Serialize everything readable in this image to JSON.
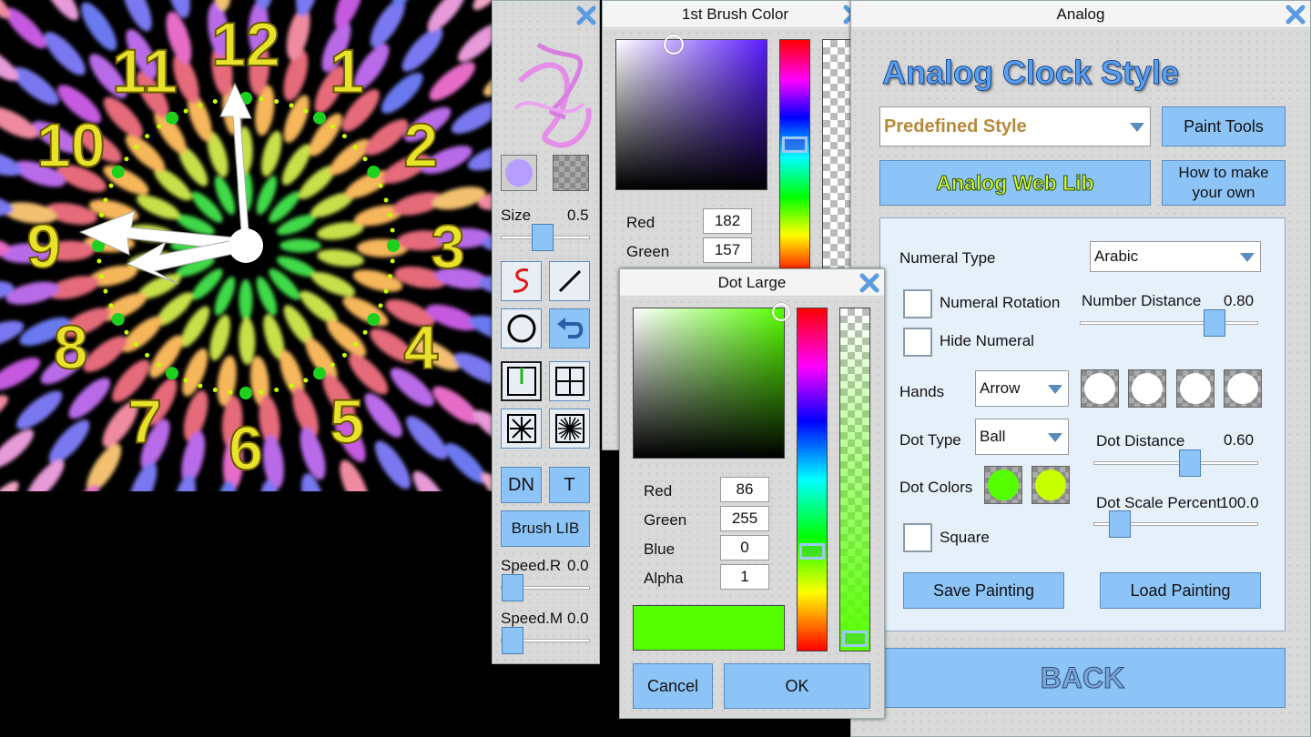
{
  "clock": {
    "numerals": [
      "12",
      "1",
      "2",
      "3",
      "4",
      "5",
      "6",
      "7",
      "8",
      "9",
      "10",
      "11"
    ]
  },
  "toolbox": {
    "size_label": "Size",
    "size_value": "0.5",
    "size_fraction": 0.5,
    "dn_label": "DN",
    "t_label": "T",
    "brush_lib_label": "Brush LIB",
    "speed_r_label": "Speed.R",
    "speed_r_value": "0.0",
    "speed_m_label": "Speed.M",
    "speed_m_value": "0.0"
  },
  "brush_color": {
    "title": "1st Brush Color",
    "red_label": "Red",
    "red_value": "182",
    "green_label": "Green",
    "green_value": "157"
  },
  "dot_large": {
    "title": "Dot Large",
    "red_label": "Red",
    "red_value": "86",
    "green_label": "Green",
    "green_value": "255",
    "blue_label": "Blue",
    "blue_value": "0",
    "alpha_label": "Alpha",
    "alpha_value": "1",
    "preview_color": "#56ff00",
    "cancel_label": "Cancel",
    "ok_label": "OK"
  },
  "analog": {
    "window_title": "Analog",
    "heading": "Analog Clock Style",
    "style_dropdown": "Predefined Style",
    "paint_tools_label": "Paint Tools",
    "web_lib_label": "Analog Web Lib",
    "how_to_label": "How to make your own",
    "numeral_type_label": "Numeral Type",
    "numeral_type_value": "Arabic",
    "numeral_rotation_label": "Numeral Rotation",
    "number_distance_label": "Number Distance",
    "number_distance_value": "0.80",
    "hide_numeral_label": "Hide Numeral",
    "hands_label": "Hands",
    "hands_value": "Arrow",
    "dot_type_label": "Dot Type",
    "dot_type_value": "Ball",
    "dot_distance_label": "Dot Distance",
    "dot_distance_value": "0.60",
    "dot_colors_label": "Dot Colors",
    "dot_color_1": "#56ff00",
    "dot_color_2": "#c8ff00",
    "dot_scale_label": "Dot Scale Percent",
    "dot_scale_value": "100.0",
    "square_label": "Square",
    "save_label": "Save Painting",
    "load_label": "Load Painting",
    "back_label": "BACK"
  }
}
